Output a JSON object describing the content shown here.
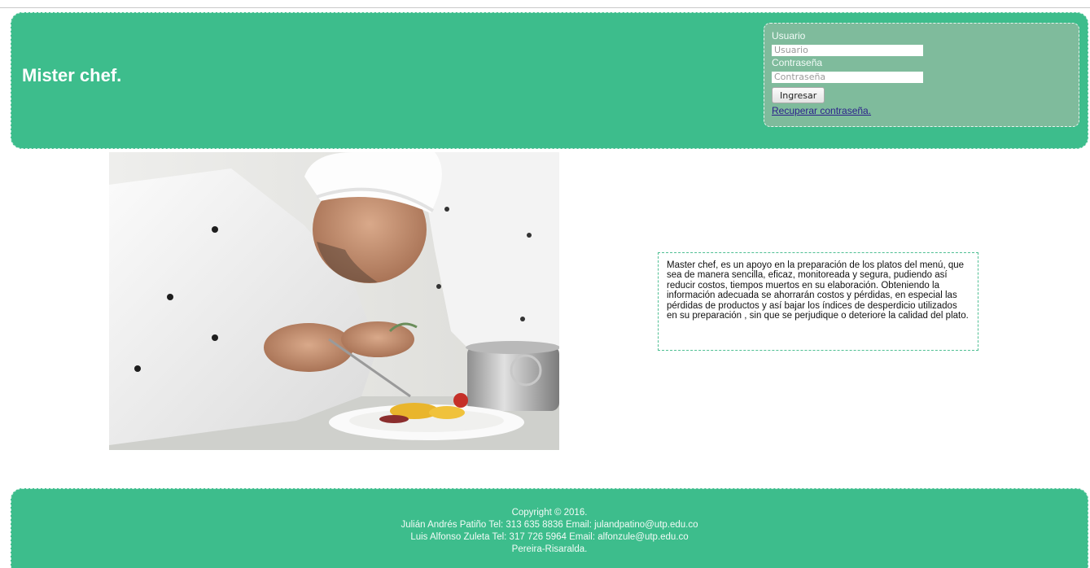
{
  "header": {
    "title": "Mister chef."
  },
  "login": {
    "user_label": "Usuario",
    "user_placeholder": "Usuario",
    "password_label": "Contraseña",
    "password_placeholder": "Contraseña",
    "submit_label": "Ingresar",
    "recover_link": "Recuperar contraseña."
  },
  "description": {
    "text": "Master chef, es un apoyo en la preparación de los platos del menú, que sea de manera sencilla, eficaz, monitoreada y segura, pudiendo así reducir costos, tiempos muertos en su elaboración. Obteniendo la información adecuada se ahorrarán costos y pérdidas, en especial las pérdidas de productos y así bajar los índices de desperdicio utilizados en su preparación , sin que se perjudique o deteriore la calidad del plato."
  },
  "footer": {
    "copyright": "Copyright © 2016.",
    "line1": "Julián Andrés Patiño Tel: 313 635 8836 Email: julandpatino@utp.edu.co",
    "line2": "Luis Alfonso Zuleta Tel: 317 726 5964 Email: alfonzule@utp.edu.co",
    "location": "Pereira-Risaralda."
  }
}
